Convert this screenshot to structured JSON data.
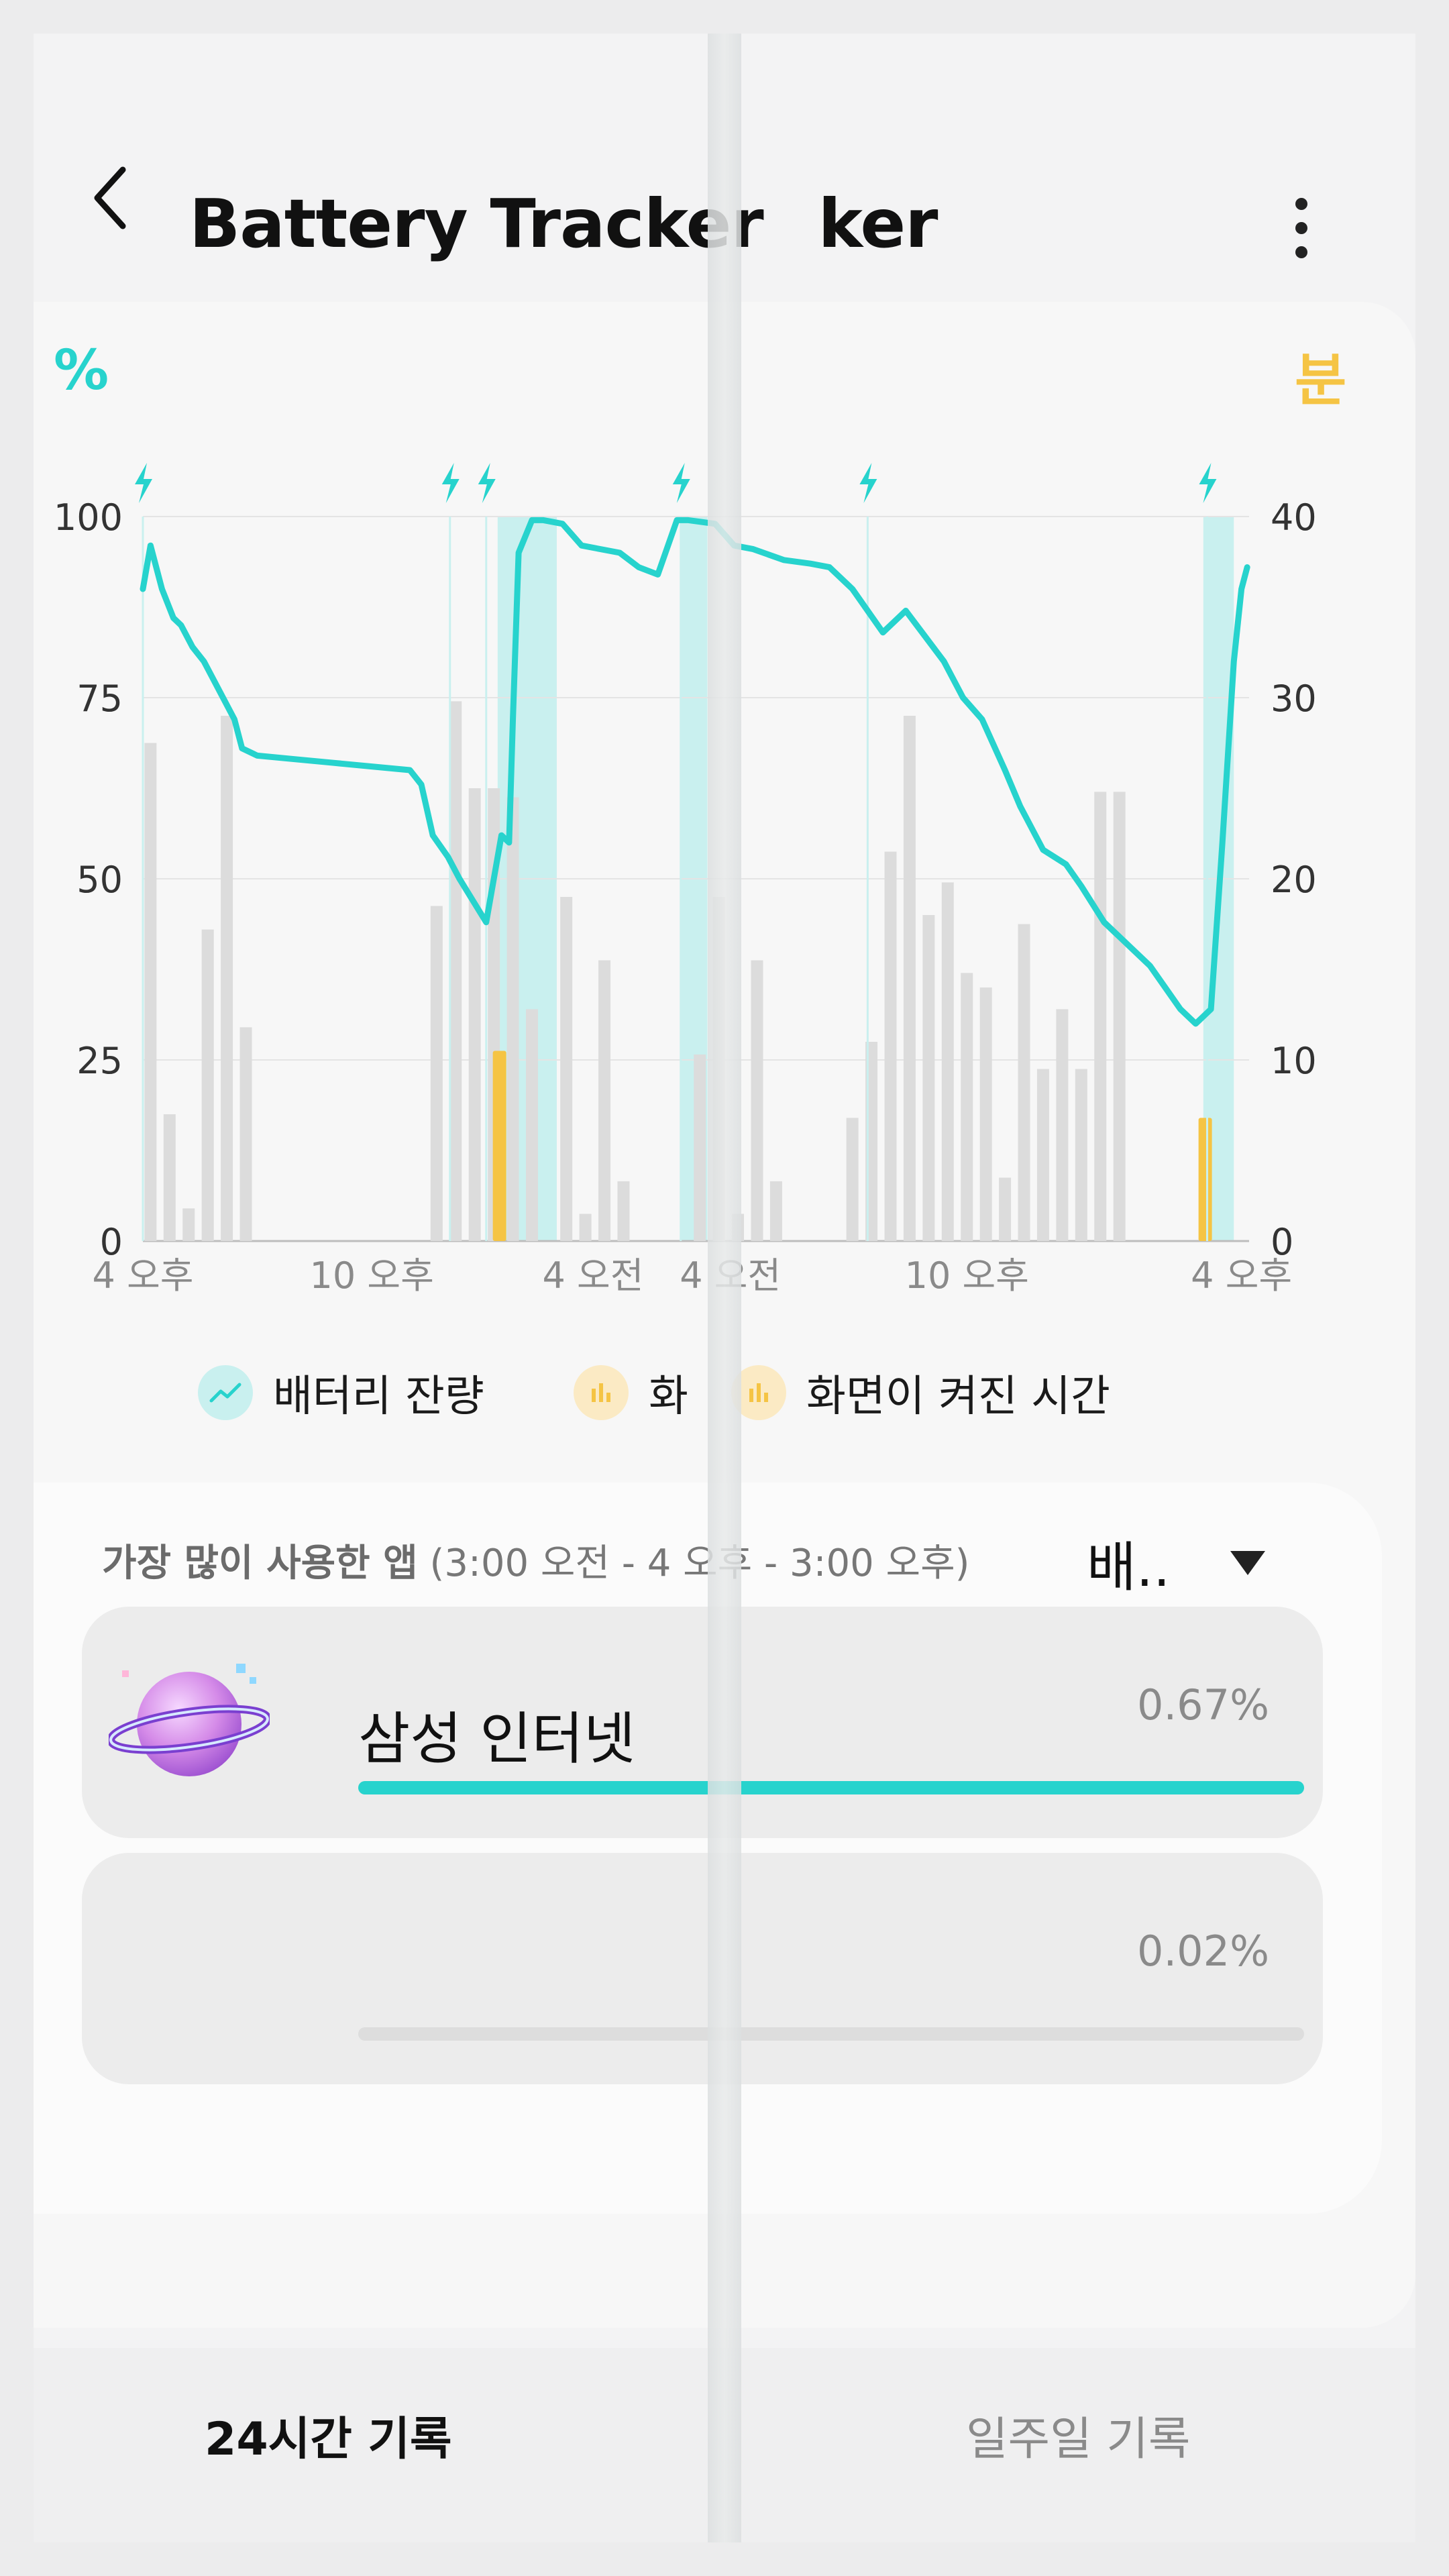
{
  "header": {
    "title": "Battery Tracker",
    "title_overlap": "ker",
    "back_icon": "chevron-left-icon",
    "menu_icon": "more-vert-icon"
  },
  "units": {
    "left": "%",
    "right": "분"
  },
  "colors": {
    "battery": "#27d3cd",
    "screen_on": "#f5c444",
    "usage_bars": "#dcdcdc",
    "charging_band": "#c9f0ef"
  },
  "chart_data": {
    "type": "line",
    "left_axis": {
      "label": "%",
      "ticks": [
        "100",
        "75",
        "50",
        "25",
        "0"
      ],
      "ylim": [
        0,
        100
      ]
    },
    "right_axis": {
      "label": "분",
      "ticks": [
        "40",
        "30",
        "20",
        "10",
        "0"
      ],
      "ylim": [
        0,
        40
      ]
    },
    "x_ticks": [
      "4 오후",
      "10 오후",
      "4 오전",
      "4 오전",
      "10 오후",
      "4 오후"
    ],
    "series": [
      {
        "name": "배터리 잔량",
        "x": [
          0,
          0.2,
          0.5,
          0.8,
          1,
          1.3,
          1.6,
          1.9,
          2.1,
          2.4,
          2.6,
          3.0,
          4.0,
          5.0,
          6.0,
          7.0,
          7.3,
          7.6,
          8.0,
          8.3,
          9.0,
          9.4,
          9.6,
          9.7,
          9.85,
          10.2,
          10.5,
          11.0,
          11.5,
          12.5,
          13.0,
          13.5,
          14.0,
          14.3,
          15.0,
          15.5,
          16.0,
          16.8,
          17.5,
          18.0,
          18.6,
          19.4,
          20.0,
          21.0,
          21.5,
          22.0,
          22.6,
          23.0,
          23.6,
          24.2,
          24.6,
          25.2,
          25.6,
          26.0,
          26.4,
          26.8,
          27.2,
          27.6,
          28.0,
          28.3,
          28.6,
          28.8,
          28.95
        ],
        "y": [
          90,
          96,
          90,
          86,
          85,
          82,
          80,
          77,
          75,
          72,
          68,
          67,
          66.5,
          66,
          65.5,
          65,
          63,
          56,
          53,
          50,
          44,
          56,
          55,
          72,
          95,
          99.5,
          99.5,
          99,
          96,
          95,
          93,
          92,
          99.5,
          99.5,
          99,
          96,
          95.5,
          94,
          93.5,
          93,
          90,
          84,
          87,
          80,
          75,
          72,
          65,
          60,
          54,
          52,
          49,
          44,
          42,
          40,
          38,
          35,
          32,
          30,
          32,
          55,
          80,
          90,
          93
        ]
      },
      {
        "name": "화면이 켜진 시간",
        "x": [
          9.35,
          27.85
        ],
        "y": [
          10.5,
          6.8
        ]
      },
      {
        "name": "usage",
        "x": [
          0.2,
          0.7,
          1.2,
          1.7,
          2.2,
          2.7,
          7.7,
          8.2,
          8.7,
          9.2,
          9.7,
          10.2,
          11.1,
          11.6,
          12.1,
          12.6,
          14.6,
          15.1,
          15.6,
          16.1,
          16.6,
          18.6,
          19.1,
          19.6,
          20.1,
          20.6,
          21.1,
          21.6,
          22.1,
          22.6,
          23.1,
          23.6,
          24.1,
          24.6,
          25.1,
          25.6,
          26.1,
          26.6,
          27.1
        ],
        "y": [
          27.5,
          7,
          1.8,
          17.2,
          29,
          11.8,
          18.5,
          29.8,
          25,
          25,
          24.5,
          12.8,
          19,
          1.5,
          15.5,
          3.3,
          10.3,
          19,
          1.5,
          15.5,
          3.3,
          6.8,
          11,
          21.5,
          29,
          18,
          19.8,
          14.8,
          14,
          3.5,
          17.5,
          9.5,
          12.8,
          9.5,
          24.8,
          24.8,
          0,
          0,
          0
        ]
      }
    ],
    "charging_periods": [
      [
        9.3,
        10.85
      ],
      [
        14.1,
        14.8
      ],
      [
        27.8,
        28.6
      ]
    ],
    "charge_events_x": [
      0,
      8.05,
      9.0,
      14.1,
      19.0,
      27.9
    ],
    "grid": true
  },
  "legend": {
    "battery_label": "배터리 잔량",
    "screen_label_partial": "화",
    "screen_label": "화면이 켜진 시간"
  },
  "apps": {
    "heading": "가장 많이 사용한 앱",
    "period": "(3:00 오전 - 4 오후 - 3:00 오후)",
    "sort_label": "배..",
    "items": [
      {
        "name": "삼성 인터넷",
        "percent": "0.67%",
        "fill": 1.0,
        "icon": "samsung-internet-planet-icon"
      },
      {
        "name": "",
        "percent": "0.02%",
        "fill": 0.0,
        "icon": ""
      }
    ]
  },
  "tabs": {
    "day": "24시간 기록",
    "week": "일주일 기록"
  }
}
